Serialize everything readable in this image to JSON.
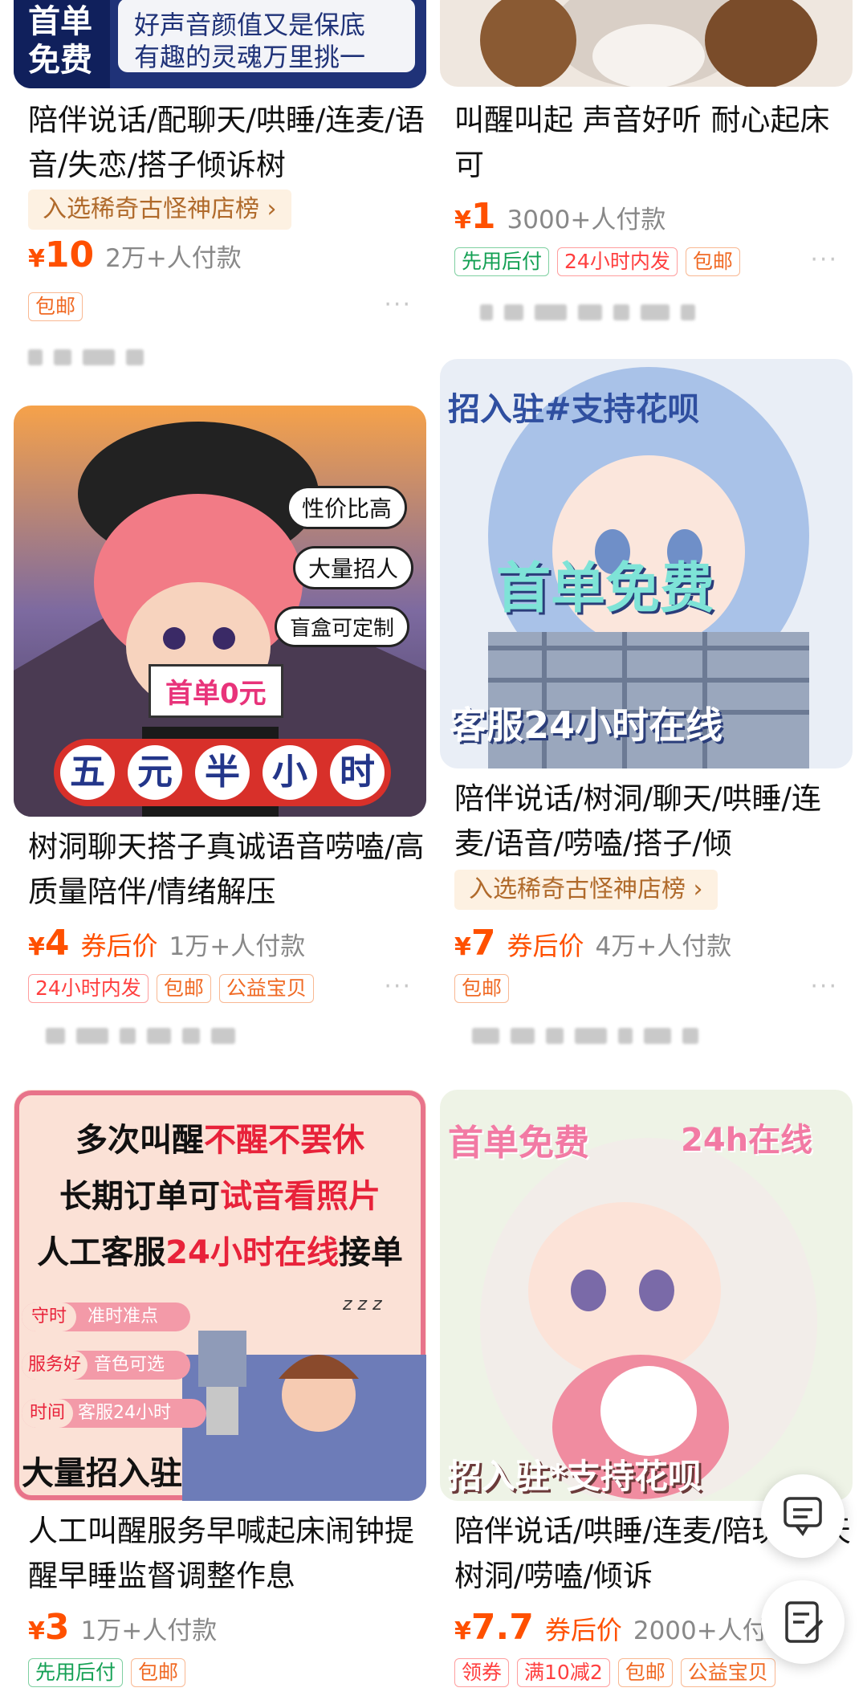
{
  "cards": {
    "c1": {
      "image_text": [
        "首单",
        "免费",
        "好声音颜值又是保底",
        "有趣的灵魂万里挑一"
      ],
      "title": "陪伴说话/配聊天/哄睡/连麦/语音/失恋/搭子倾诉树",
      "rank_badge": "入选稀奇古怪神店榜 ›",
      "yen": "¥",
      "price": "10",
      "sold": "2万+人付款",
      "tags": [
        "包邮"
      ],
      "more": "···"
    },
    "c2": {
      "title": "叫醒叫起 声音好听 耐心起床可",
      "yen": "¥",
      "price": "1",
      "sold": "3000+人付款",
      "tags": [
        "先用后付",
        "24小时内发",
        "包邮"
      ],
      "more": "···"
    },
    "c3": {
      "image_text": [
        "性价比高",
        "大量招人",
        "盲盒可定制",
        "首单0元",
        "五",
        "元",
        "半",
        "小",
        "时"
      ],
      "title": "树洞聊天搭子真诚语音唠嗑/高质量陪伴/情绪解压",
      "yen": "¥",
      "price": "4",
      "coupon_label": "券后价",
      "sold": "1万+人付款",
      "tags": [
        "24小时内发",
        "包邮",
        "公益宝贝"
      ],
      "more": "···"
    },
    "c4": {
      "image_text": [
        "招入驻#支持花呗",
        "首单免费",
        "客服24小时在线"
      ],
      "title": "陪伴说话/树洞/聊天/哄睡/连麦/语音/唠嗑/搭子/倾",
      "rank_badge": "入选稀奇古怪神店榜 ›",
      "yen": "¥",
      "price": "7",
      "coupon_label": "券后价",
      "sold": "4万+人付款",
      "tags": [
        "包邮"
      ],
      "more": "···"
    },
    "c5": {
      "image_text": {
        "line1a": "多次叫醒",
        "line1b": "不醒不罢休",
        "line2a": "长期订单可",
        "line2b": "试音看照片",
        "line3a": "人工客服",
        "line3b": "24小时在线",
        "line3c": "接单",
        "p1a": "守时",
        "p1b": "准时准点",
        "p2a": "服务好",
        "p2b": "音色可选",
        "p3a": "时间",
        "p3b": "客服24小时",
        "footer": "大量招入驻",
        "zzz": "z z z"
      },
      "title": "人工叫醒服务早喊起床闹钟提醒早睡监督调整作息",
      "yen": "¥",
      "price": "3",
      "sold": "1万+人付款",
      "tags": [
        "先用后付",
        "包邮"
      ]
    },
    "c6": {
      "image_text": [
        "首单免费",
        "24h在线",
        "招入驻*支持花呗"
      ],
      "title": "陪伴说话/哄睡/连麦/陪玩/聊天树洞/唠嗑/倾诉",
      "yen": "¥",
      "price": "7.7",
      "coupon_label": "券后价",
      "sold": "2000+人付款",
      "tags": [
        "领券",
        "满10减2",
        "包邮",
        "公益宝贝"
      ]
    }
  },
  "floating": {
    "chat_icon": "chat-bubble-icon",
    "edit_icon": "edit-note-icon"
  },
  "colors": {
    "price": "#ff5000",
    "tag_green": "#14a054",
    "tag_red": "#ff3f3f",
    "tag_orange": "#f06a24",
    "rank_bg": "#fdf1e2",
    "rank_text": "#b06a2b"
  }
}
